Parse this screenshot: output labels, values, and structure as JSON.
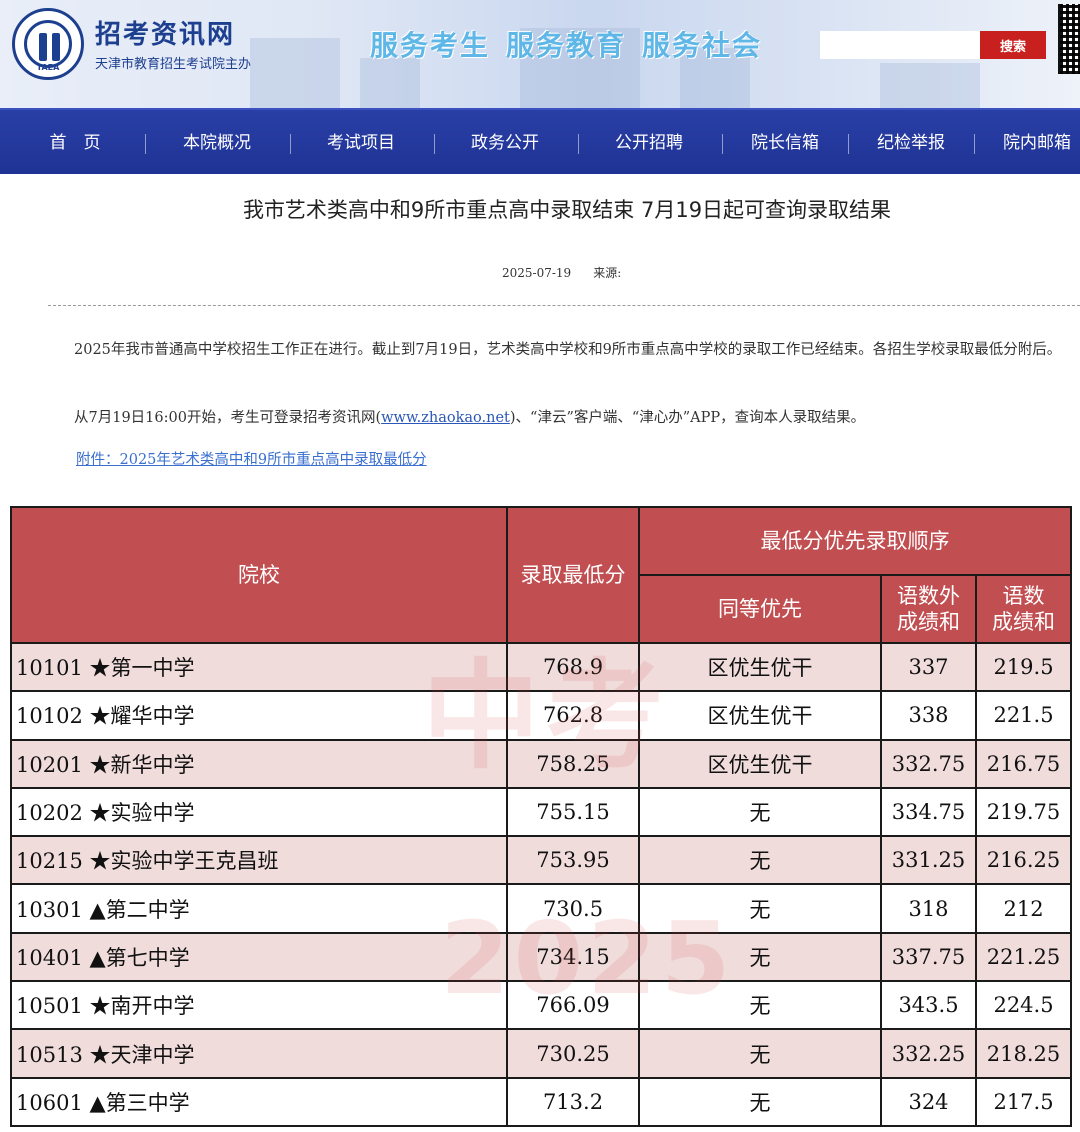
{
  "header": {
    "logo_text": "TAEA",
    "site_name": "招考资讯网",
    "site_subtitle": "天津市教育招生考试院主办",
    "slogans": [
      "服务考生",
      "服务教育",
      "服务社会"
    ],
    "search": {
      "placeholder": "",
      "button_label": "搜索"
    }
  },
  "nav": {
    "items": [
      {
        "label": "首　页"
      },
      {
        "label": "本院概况"
      },
      {
        "label": "考试项目"
      },
      {
        "label": "政务公开"
      },
      {
        "label": "公开招聘"
      },
      {
        "label": "院长信箱"
      },
      {
        "label": "纪检举报"
      },
      {
        "label": "院内邮箱"
      }
    ]
  },
  "article": {
    "title": "我市艺术类高中和9所市重点高中录取结束 7月19日起可查询录取结果",
    "date": "2025-07-19",
    "source_label": "来源:",
    "paragraph1": "2025年我市普通高中学校招生工作正在进行。截止到7月19日，艺术类高中学校和9所市重点高中学校的录取工作已经结束。各招生学校录取最低分附后。",
    "paragraph2_before": "从7月19日16:00开始，考生可登录招考资讯网(",
    "paragraph2_link": "www.zhaokao.net",
    "paragraph2_after": ")、“津云”客户端、“津心办”APP，查询本人录取结果。",
    "attachment_link": "附件：2025年艺术类高中和9所市重点高中录取最低分"
  },
  "table": {
    "headers": {
      "school": "院校",
      "min_score": "录取最低分",
      "order_group": "最低分优先录取顺序",
      "equal_priority": "同等优先",
      "sum3_line1": "语数外",
      "sum3_line2": "成绩和",
      "sum2_line1": "语数",
      "sum2_line2": "成绩和"
    },
    "rows": [
      {
        "school": "10101 ★第一中学",
        "min_score": "768.9",
        "priority": "区优生优干",
        "sum3": "337",
        "sum2": "219.5"
      },
      {
        "school": "10102 ★耀华中学",
        "min_score": "762.8",
        "priority": "区优生优干",
        "sum3": "338",
        "sum2": "221.5"
      },
      {
        "school": "10201 ★新华中学",
        "min_score": "758.25",
        "priority": "区优生优干",
        "sum3": "332.75",
        "sum2": "216.75"
      },
      {
        "school": "10202 ★实验中学",
        "min_score": "755.15",
        "priority": "无",
        "sum3": "334.75",
        "sum2": "219.75"
      },
      {
        "school": "10215 ★实验中学王克昌班",
        "min_score": "753.95",
        "priority": "无",
        "sum3": "331.25",
        "sum2": "216.25"
      },
      {
        "school": "10301 ▲第二中学",
        "min_score": "730.5",
        "priority": "无",
        "sum3": "318",
        "sum2": "212"
      },
      {
        "school": "10401 ▲第七中学",
        "min_score": "734.15",
        "priority": "无",
        "sum3": "337.75",
        "sum2": "221.25"
      },
      {
        "school": "10501 ★南开中学",
        "min_score": "766.09",
        "priority": "无",
        "sum3": "343.5",
        "sum2": "224.5"
      },
      {
        "school": "10513 ★天津中学",
        "min_score": "730.25",
        "priority": "无",
        "sum3": "332.25",
        "sum2": "218.25"
      },
      {
        "school": "10601 ▲第三中学",
        "min_score": "713.2",
        "priority": "无",
        "sum3": "324",
        "sum2": "217.5"
      }
    ]
  },
  "watermark": {
    "line1": "中考",
    "line2": "2025"
  },
  "colors": {
    "nav_bg": "#2a3fa6",
    "table_header_bg": "#c14f52",
    "row_stripe": "#f1dcdc",
    "search_button": "#c8201e"
  }
}
